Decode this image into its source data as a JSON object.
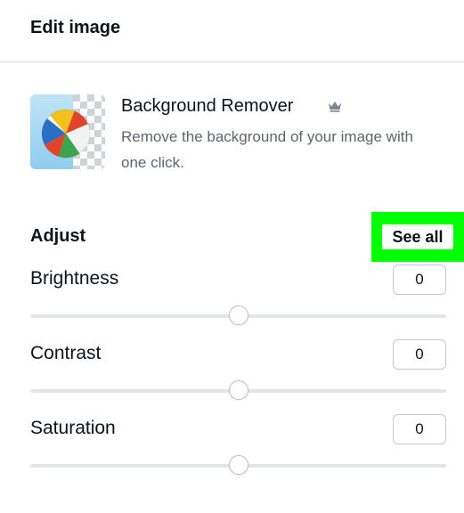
{
  "header": {
    "title": "Edit image"
  },
  "background_remover": {
    "title": "Background Remover",
    "description": "Remove the background of your image with one click.",
    "badge_icon": "crown-icon"
  },
  "adjust": {
    "label": "Adjust",
    "see_all_label": "See all",
    "sliders": [
      {
        "name": "Brightness",
        "value": "0",
        "level": 0.5
      },
      {
        "name": "Contrast",
        "value": "0",
        "level": 0.5
      },
      {
        "name": "Saturation",
        "value": "0",
        "level": 0.5
      }
    ]
  },
  "colors": {
    "highlight": "#00ff00",
    "track": "#e3e5e8",
    "text": "#0e1318",
    "muted": "#5e6570"
  }
}
